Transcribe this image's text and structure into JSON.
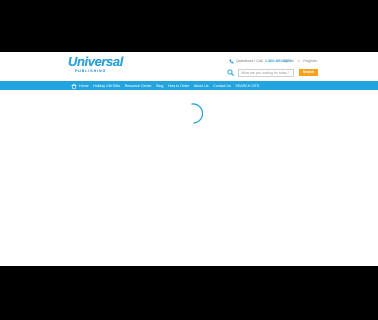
{
  "colors": {
    "brand_blue": "#22a5de",
    "logo_blue": "#2aa3dc",
    "logo_dark": "#1b86c0",
    "search_button": "#f6a21e",
    "letterbox": "#000000",
    "page_background": "#ffffff"
  },
  "header": {
    "logo_text": "Universal",
    "logo_subtext": "PUBLISHING",
    "contact_label": "Questions? Call",
    "phone_number": "1-800-891-5576",
    "sign_in": "Sign In",
    "separator": "or",
    "register": "Register",
    "search_placeholder": "What are you looking for today?",
    "search_button": "Search"
  },
  "nav": {
    "items": [
      {
        "label": "Home",
        "icon": "home-icon"
      },
      {
        "label": "Holiday Gift Gifts"
      },
      {
        "label": "Resource Center"
      },
      {
        "label": "Blog"
      },
      {
        "label": "How to Order"
      },
      {
        "label": "About Us"
      },
      {
        "label": "Contact Us"
      },
      {
        "label": "SEARCH SITE"
      }
    ]
  },
  "main": {
    "state": "loading",
    "indicator_icon": "loading-spinner-icon"
  }
}
